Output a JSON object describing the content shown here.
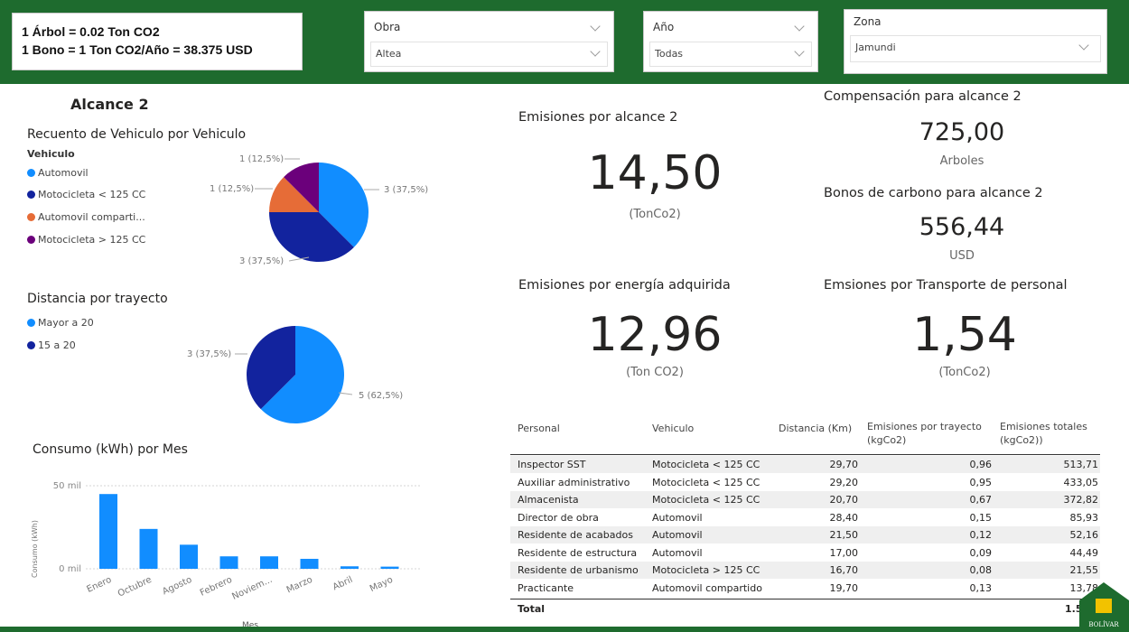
{
  "header": {
    "info_line1": "1 Árbol = 0.02 Ton CO2",
    "info_line2": "1 Bono = 1 Ton CO2/Año = 38.375 USD",
    "slicers": {
      "obra": {
        "title": "Obra",
        "value": "Altea"
      },
      "anio": {
        "title": "Año",
        "value": "Todas"
      },
      "zona": {
        "title": "Zona",
        "value": "Jamundi"
      }
    }
  },
  "section_title": "Alcance 2",
  "vehiculo_chart": {
    "title": "Recuento de Vehiculo por Vehiculo",
    "legend_title": "Vehiculo",
    "legend": [
      "Automovil",
      "Motocicleta < 125 CC",
      "Automovil comparti...",
      "Motocicleta > 125 CC"
    ],
    "labels": [
      "3 (37,5%)",
      "3 (37,5%)",
      "1 (12,5%)",
      "1 (12,5%)"
    ],
    "colors": [
      "#118DFF",
      "#12239E",
      "#E66C37",
      "#6B007B"
    ]
  },
  "distancia_chart": {
    "title": "Distancia por trayecto",
    "legend": [
      "Mayor a 20",
      "15 a 20"
    ],
    "labels": [
      "5 (62,5%)",
      "3 (37,5%)"
    ],
    "colors": [
      "#118DFF",
      "#12239E"
    ]
  },
  "consumo_chart": {
    "title": "Consumo (kWh) por Mes",
    "ylabel": "Consumo (kWh)",
    "xlabel": "Mes",
    "ytick_top": "50 mil",
    "ytick_zero": "0 mil",
    "color": "#118DFF"
  },
  "chart_data": [
    {
      "type": "pie",
      "title": "Recuento de Vehiculo por Vehiculo",
      "categories": [
        "Automovil",
        "Motocicleta < 125 CC",
        "Automovil compartido",
        "Motocicleta > 125 CC"
      ],
      "values": [
        3,
        3,
        1,
        1
      ]
    },
    {
      "type": "pie",
      "title": "Distancia por trayecto",
      "categories": [
        "Mayor a 20",
        "15 a 20"
      ],
      "values": [
        5,
        3
      ]
    },
    {
      "type": "bar",
      "title": "Consumo (kWh) por Mes",
      "xlabel": "Mes",
      "ylabel": "Consumo (kWh)",
      "categories": [
        "Enero",
        "Octubre",
        "Agosto",
        "Febrero",
        "Noviem...",
        "Marzo",
        "Abril",
        "Mayo"
      ],
      "values": [
        45000,
        24000,
        14500,
        7500,
        7500,
        6000,
        1500,
        1300
      ],
      "ylim": [
        0,
        50000
      ]
    }
  ],
  "cards": {
    "alcance": {
      "title": "Emisiones por alcance 2",
      "value": "14,50",
      "unit": "(TonCo2)"
    },
    "energia": {
      "title": "Emisiones por energía adquirida",
      "value": "12,96",
      "unit": "(Ton CO2)"
    },
    "transporte": {
      "title": "Emsiones por Transporte de personal",
      "value": "1,54",
      "unit": "(TonCo2)"
    },
    "compensacion": {
      "title": "Compensación para alcance 2",
      "value": "725,00",
      "unit": "Arboles"
    },
    "bonos": {
      "title": "Bonos de carbono para alcance 2",
      "value": "556,44",
      "unit": "USD"
    }
  },
  "table": {
    "headers": [
      "Personal",
      "Vehiculo",
      "Distancia (Km)",
      "Emisiones por trayecto (kgCo2)",
      "Emisiones totales (kgCo2))"
    ],
    "rows": [
      [
        "Inspector SST",
        "Motocicleta < 125 CC",
        "29,70",
        "0,96",
        "513,71"
      ],
      [
        "Auxiliar administrativo",
        "Motocicleta < 125 CC",
        "29,20",
        "0,95",
        "433,05"
      ],
      [
        "Almacenista",
        "Motocicleta < 125 CC",
        "20,70",
        "0,67",
        "372,82"
      ],
      [
        "Director de obra",
        "Automovil",
        "28,40",
        "0,15",
        "85,93"
      ],
      [
        "Residente de acabados",
        "Automovil",
        "21,50",
        "0,12",
        "52,16"
      ],
      [
        "Residente de estructura",
        "Automovil",
        "17,00",
        "0,09",
        "44,49"
      ],
      [
        "Residente de urbanismo",
        "Motocicleta > 125 CC",
        "16,70",
        "0,08",
        "21,55"
      ],
      [
        "Practicante",
        "Automovil compartido",
        "19,70",
        "0,13",
        "13,78"
      ]
    ],
    "total_label": "Total",
    "total_value": "1.537,"
  },
  "logo": {
    "text": "BOLÍVAR",
    "color": "#1e6b2e",
    "accent": "#f2c200"
  }
}
